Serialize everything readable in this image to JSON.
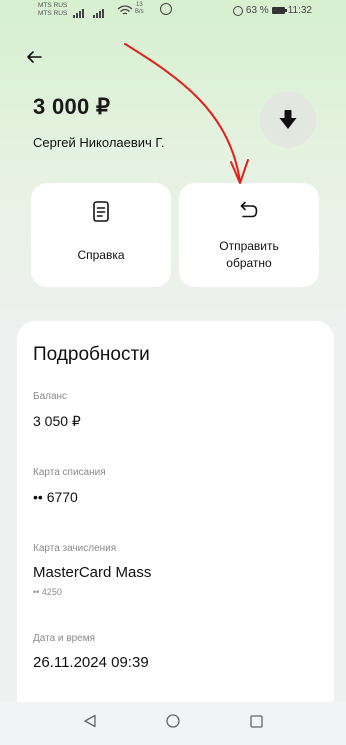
{
  "status_bar": {
    "carrier_1": "MTS RUS",
    "carrier_2": "MTS RUS",
    "net_speed_value": "13",
    "net_speed_unit": "B/s",
    "battery": "63 %",
    "time": "11:32"
  },
  "header": {
    "amount": "3 000 ₽",
    "recipient": "Сергей Николаевич Г."
  },
  "actions": {
    "certificate_label": "Справка",
    "send_back_line1": "Отправить",
    "send_back_line2": "обратно"
  },
  "details": {
    "title": "Подробности",
    "balance_label": "Баланс",
    "balance_value": "3 050 ₽",
    "debit_card_label": "Карта списания",
    "debit_card_value": "•• 6770",
    "credit_card_label": "Карта зачисления",
    "credit_card_value": "MasterCard Mass",
    "credit_card_number": "•• 4250",
    "datetime_label": "Дата и время",
    "datetime_value": "26.11.2024 09:39"
  },
  "annotation_color": "#e0201b"
}
